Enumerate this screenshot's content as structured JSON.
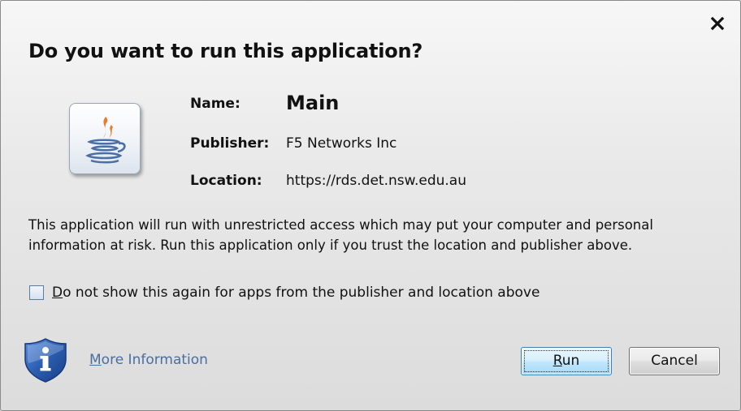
{
  "dialog": {
    "title": "Do you want to run this application?",
    "close_icon": "close-icon"
  },
  "app": {
    "icon": "java-coffee-cup-icon",
    "name_label": "Name:",
    "name_value": "Main",
    "publisher_label": "Publisher:",
    "publisher_value": "F5 Networks Inc",
    "location_label": "Location:",
    "location_value": "https://rds.det.nsw.edu.au"
  },
  "warning": {
    "text": "This application will run with unrestricted access which may put your computer and personal information at risk. Run this application only if you trust the location and publisher above."
  },
  "checkbox": {
    "checked": false,
    "label_first": "D",
    "label_rest": "o not show this again for apps from the publisher and location above"
  },
  "footer": {
    "info_icon": "shield-info-icon",
    "more_info_first": "M",
    "more_info_rest": "ore Information",
    "run_first": "R",
    "run_rest": "un",
    "cancel_label": "Cancel"
  },
  "colors": {
    "link": "#4a6ea0",
    "shield_blue": "#2a5db0",
    "run_button_border": "#3c7fb1"
  }
}
